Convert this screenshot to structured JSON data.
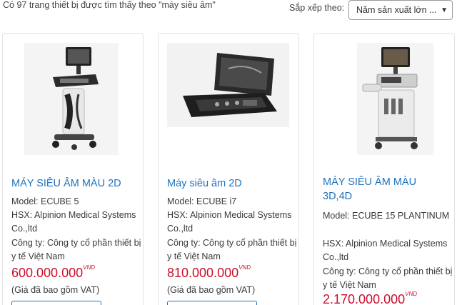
{
  "results": {
    "count_text": "Có 97 trang thiết bị được tìm thấy theo \"máy siêu âm\""
  },
  "sort": {
    "label": "Sắp xếp theo:",
    "selected": "Năm sản xuất lớn ..."
  },
  "products": [
    {
      "title": "MÁY SIÊU ÂM MÀU 2D",
      "model": "Model: ECUBE 5",
      "hsx": "HSX: Alpinion Medical Systems Co.,ltd",
      "company": "Công ty: Công ty cổ phần thiết bị y tế Việt Nam",
      "price": "600.000.000",
      "currency": "VND",
      "vat_note": "(Giá đã bao gồm VAT)"
    },
    {
      "title": "Máy siêu âm 2D",
      "model": "Model: ECUBE i7",
      "hsx": "HSX: Alpinion Medical Systems Co.,ltd",
      "company": "Công ty: Công ty cổ phần thiết bị y tế Việt Nam",
      "price": "810.000.000",
      "currency": "VND",
      "vat_note": "(Giá đã bao gồm VAT)"
    },
    {
      "title": "MÁY SIÊU ÂM MÀU 3D,4D",
      "model": "Model: ECUBE 15 PLANTINUM",
      "hsx": "HSX: Alpinion Medical Systems Co.,ltd",
      "company": "Công ty: Công ty cổ phần thiết bị y tế Việt Nam",
      "price": "2.170.000.000",
      "currency": "VND"
    }
  ],
  "colors": {
    "link": "#1e73be",
    "price": "#c8102e"
  },
  "icons": {
    "sort_chevron": "chevron-down-icon"
  }
}
